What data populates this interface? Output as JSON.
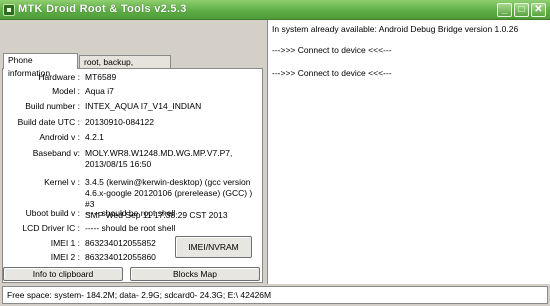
{
  "window": {
    "title": "MTK Droid Root & Tools v2.5.3",
    "min_glyph": "_",
    "max_glyph": "□",
    "close_glyph": "✕"
  },
  "tabs": [
    {
      "label": "Phone information",
      "active": true
    },
    {
      "label": "root, backup, recovery",
      "active": false
    }
  ],
  "phone_info": [
    {
      "label": "Hardware :",
      "value": "MT6589"
    },
    {
      "label": "Model :",
      "value": "Aqua i7"
    },
    {
      "label": "Build number :",
      "value": "INTEX_AQUA I7_V14_INDIAN"
    },
    {
      "label": "Build date UTC :",
      "value": "20130910-084122"
    },
    {
      "label": "Android  v :",
      "value": "4.2.1"
    },
    {
      "label": "Baseband v:",
      "value": "MOLY.WR8.W1248.MD.WG.MP.V7.P7,\n2013/08/15 16:50"
    },
    {
      "label": "Kernel v :",
      "value": "3.4.5 (kerwin@kerwin-desktop) (gcc version\n4.6.x-google 20120106 (prerelease) (GCC) ) #3\nSMP  Wed Sep 11 17:38:29 CST 2013"
    },
    {
      "label": "Uboot build v :",
      "value": "----- should be  root shell"
    },
    {
      "label": "LCD Driver IC :",
      "value": "----- should be  root shell"
    },
    {
      "label": "IMEI 1 :",
      "value": "863234012055852"
    },
    {
      "label": "IMEI 2 :",
      "value": "863234012055860"
    }
  ],
  "buttons": {
    "imei": "IMEI/NVRAM",
    "clipboard": "Info to clipboard",
    "blocks": "Blocks Map"
  },
  "log": [
    "In system already available:  Android Debug Bridge version 1.0.26",
    " --->>> Connect to device <<<---",
    " --->>> Connect to device <<<---"
  ],
  "status": "Free space: system- 184.2M; data- 2.9G; sdcard0- 24.3G;  E:\\ 42426M"
}
